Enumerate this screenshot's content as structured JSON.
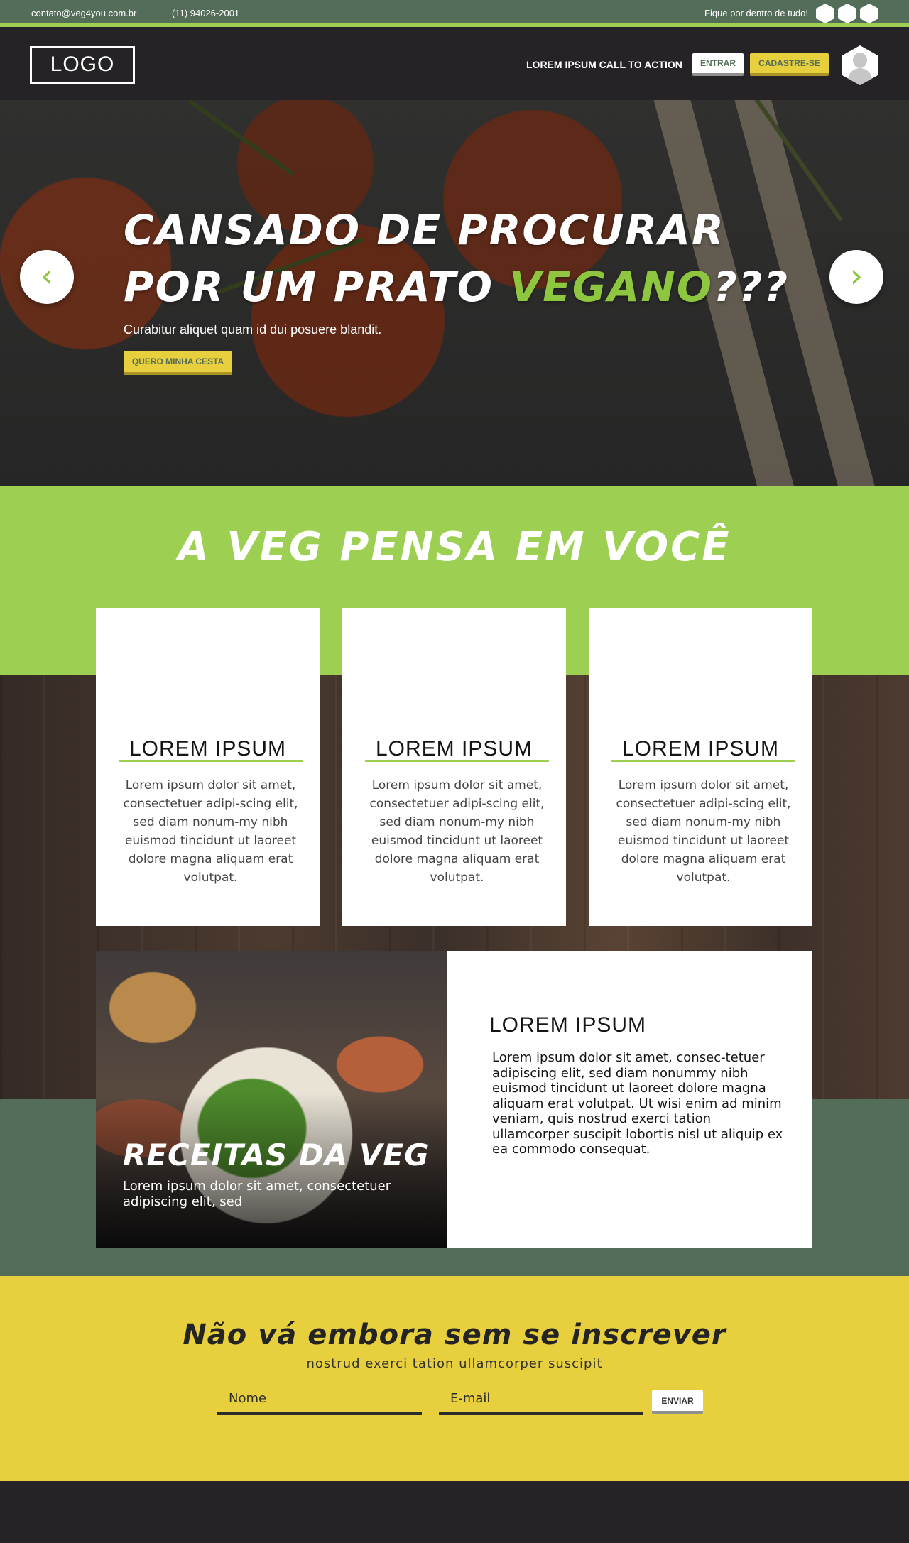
{
  "topbar": {
    "email": "contato@veg4you.com.br",
    "phone": "(11) 94026-2001",
    "follow_text": "Fique por dentro de tudo!",
    "social_icons": [
      "social-hexagon-icon",
      "social-hexagon-icon",
      "social-hexagon-icon"
    ]
  },
  "header": {
    "logo": "LOGO",
    "cta": "LOREM IPSUM CALL TO ACTION",
    "login_label": "ENTRAR",
    "signup_label": "CADASTRE-SE",
    "avatar_icon": "user-avatar-icon"
  },
  "hero": {
    "title_line1": "CANSADO DE PROCURAR",
    "title_line2_start": "POR UM PRATO ",
    "title_highlight": "VEGANO",
    "title_line2_end": "???",
    "subtitle": "Curabitur aliquet quam id dui posuere blandit.",
    "button_label": "QUERO MINHA CESTA",
    "prev_icon": "‹",
    "next_icon": "›"
  },
  "features": {
    "heading": "A VEG PENSA EM VOCÊ",
    "cards": [
      {
        "title": "LOREM IPSUM",
        "text": "Lorem ipsum dolor sit amet, consectetuer adipi-scing elit, sed diam nonum-my nibh euismod tincidunt ut laoreet dolore magna aliquam erat volutpat."
      },
      {
        "title": "LOREM IPSUM",
        "text": "Lorem ipsum dolor sit amet, consectetuer adipi-scing elit, sed diam nonum-my nibh euismod tincidunt ut laoreet dolore magna aliquam erat volutpat."
      },
      {
        "title": "LOREM IPSUM",
        "text": "Lorem ipsum dolor sit amet, consectetuer adipi-scing elit, sed diam nonum-my nibh euismod tincidunt ut laoreet dolore magna aliquam erat volutpat."
      }
    ]
  },
  "recipes": {
    "title": "RECEITAS DA VEG",
    "subtitle": "Lorem ipsum dolor sit amet, consectetuer adipiscing elit, sed",
    "side_title": "LOREM IPSUM",
    "side_text": "Lorem ipsum dolor sit amet, consec-tetuer adipiscing elit, sed diam nonummy nibh euismod tincidunt ut laoreet dolore magna aliquam erat volutpat. Ut wisi enim ad minim veniam, quis nostrud exerci tation ullamcorper suscipit lobortis nisl ut aliquip ex ea commodo consequat."
  },
  "subscribe": {
    "heading": "Não vá embora sem se inscrever",
    "subtitle": "nostrud exerci tation ullamcorper suscipit",
    "name_placeholder": "Nome",
    "email_placeholder": "E-mail",
    "button_label": "ENVIAR"
  },
  "colors": {
    "brand_green": "#9dd052",
    "dark_green": "#546d58",
    "yellow": "#e8cf3d",
    "dark": "#252326"
  }
}
